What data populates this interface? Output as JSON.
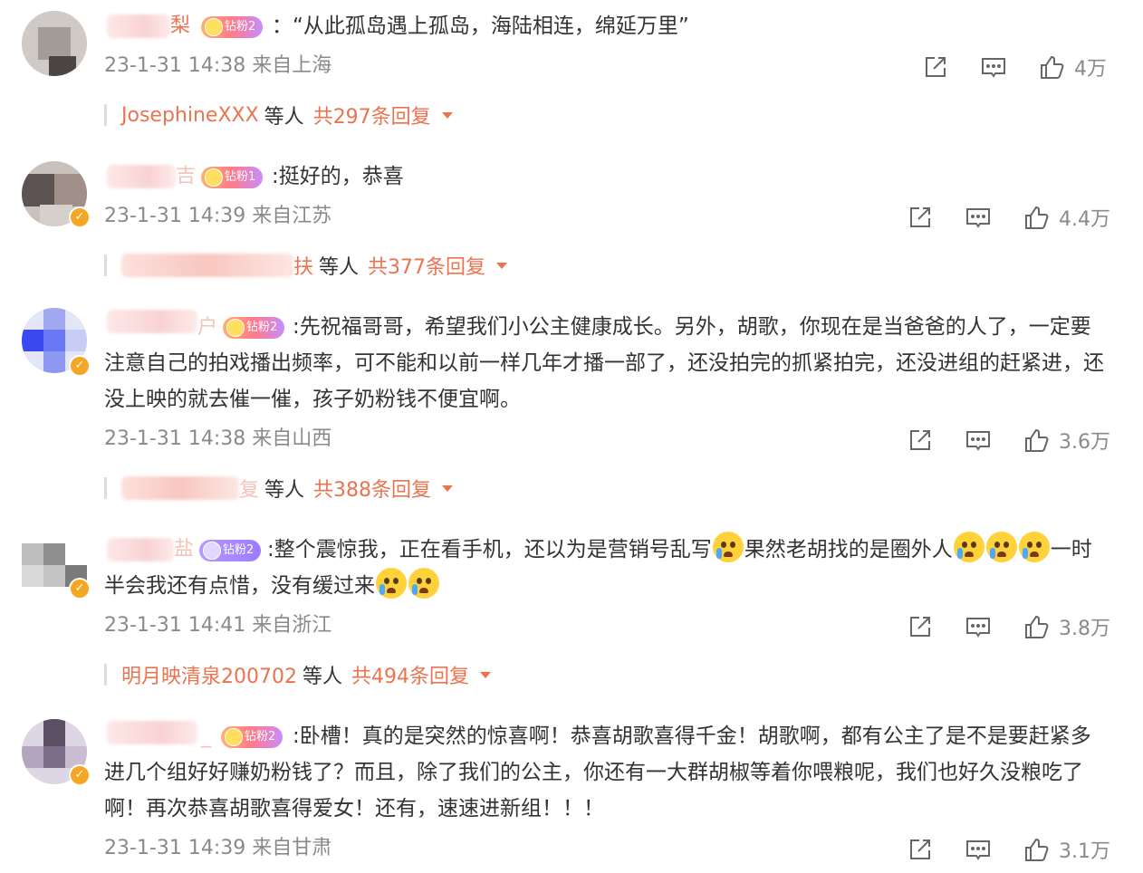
{
  "colors": {
    "accent": "#eb7350",
    "meta": "#8a8a8a",
    "text": "#333333",
    "badge_gold": "#f5a623"
  },
  "comments": [
    {
      "name_suffix": "梨",
      "fan_badge": "钻粉2",
      "text": "：“从此孤岛遇上孤岛，海陆相连，绵延万里”",
      "time": "23-1-31 14:38",
      "location": "来自上海",
      "likes": "4万",
      "reply_users": "JosephineXXX",
      "reply_etc": "等人",
      "reply_count": "共297条回复"
    },
    {
      "name_suffix": "吉",
      "fan_badge": "钻粉1",
      "text": ":挺好的，恭喜",
      "time": "23-1-31 14:39",
      "location": "来自江苏",
      "likes": "4.4万",
      "reply_users_suffix": "扶",
      "reply_etc": "等人",
      "reply_count": "共377条回复"
    },
    {
      "name_suffix": "户",
      "fan_badge": "钻粉2",
      "text": ":先祝福哥哥，希望我们小公主健康成长。另外，胡歌，你现在是当爸爸的人了，一定要注意自己的拍戏播出频率，可不能和以前一样几年才播一部了，还没拍完的抓紧拍完，还没进组的赶紧进，还没上映的就去催一催，孩子奶粉钱不便宜啊。",
      "time": "23-1-31 14:38",
      "location": "来自山西",
      "likes": "3.6万",
      "reply_users_suffix": "复",
      "reply_etc": "等人",
      "reply_count": "共388条回复"
    },
    {
      "name_suffix": "盐",
      "fan_badge": "钻粉2",
      "text_part1": ":整个震惊我，正在看手机，还以为是营销号乱写",
      "text_part2": "果然老胡找的是圈外人",
      "text_part3": "一时半会我还有点惜，没有缓过来",
      "time": "23-1-31 14:41",
      "location": "来自浙江",
      "likes": "3.8万",
      "reply_users": "明月映清泉200702",
      "reply_etc": "等人",
      "reply_count": "共494条回复"
    },
    {
      "name_suffix": "_",
      "fan_badge": "钻粉2",
      "text": ":卧槽！真的是突然的惊喜啊！恭喜胡歌喜得千金！胡歌啊，都有公主了是不是要赶紧多进几个组好好赚奶粉钱了？而且，除了我们的公主，你还有一大群胡椒等着你喂粮呢，我们也好久没粮吃了啊！再次恭喜胡歌喜得爱女！还有，速速进新组！！！",
      "time": "23-1-31 14:39",
      "location": "来自甘肃",
      "likes": "3.1万"
    }
  ],
  "icons": {
    "share": "share-icon",
    "comment": "comment-icon",
    "like": "like-icon",
    "verified": "verified-icon",
    "emoji": "crying-emoji"
  }
}
